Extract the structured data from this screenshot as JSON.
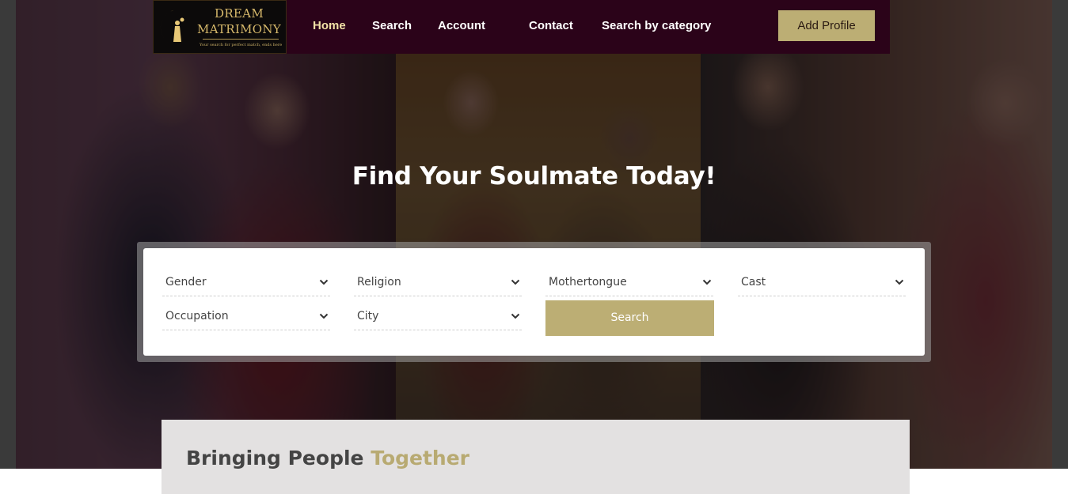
{
  "brand": {
    "logo_line1": "DREAM",
    "logo_line2": "MATRIMONY",
    "tagline": "Your search for perfect match, ends here.",
    "accent_color": "#bcae74",
    "nav_background": "#2b0319"
  },
  "nav": {
    "items": [
      {
        "label": "Home",
        "active": true
      },
      {
        "label": "Search",
        "active": false
      },
      {
        "label": "Account",
        "active": false
      },
      {
        "label": "Contact",
        "active": false
      },
      {
        "label": "Search by category",
        "active": false
      }
    ],
    "cta_label": "Add Profile"
  },
  "hero": {
    "headline": "Find Your Soulmate Today!"
  },
  "search_form": {
    "filters": [
      {
        "value": "Gender",
        "icon": "chevron-down-icon"
      },
      {
        "value": "Religion",
        "icon": "chevron-down-icon"
      },
      {
        "value": "Mothertongue",
        "icon": "chevron-down-icon"
      },
      {
        "value": "Cast",
        "icon": "chevron-down-icon"
      },
      {
        "value": "Occupation",
        "icon": "chevron-down-icon"
      },
      {
        "value": "City",
        "icon": "chevron-down-icon"
      }
    ],
    "submit_label": "Search"
  },
  "section": {
    "title_part1": "Bringing People",
    "title_part2": "Together"
  }
}
